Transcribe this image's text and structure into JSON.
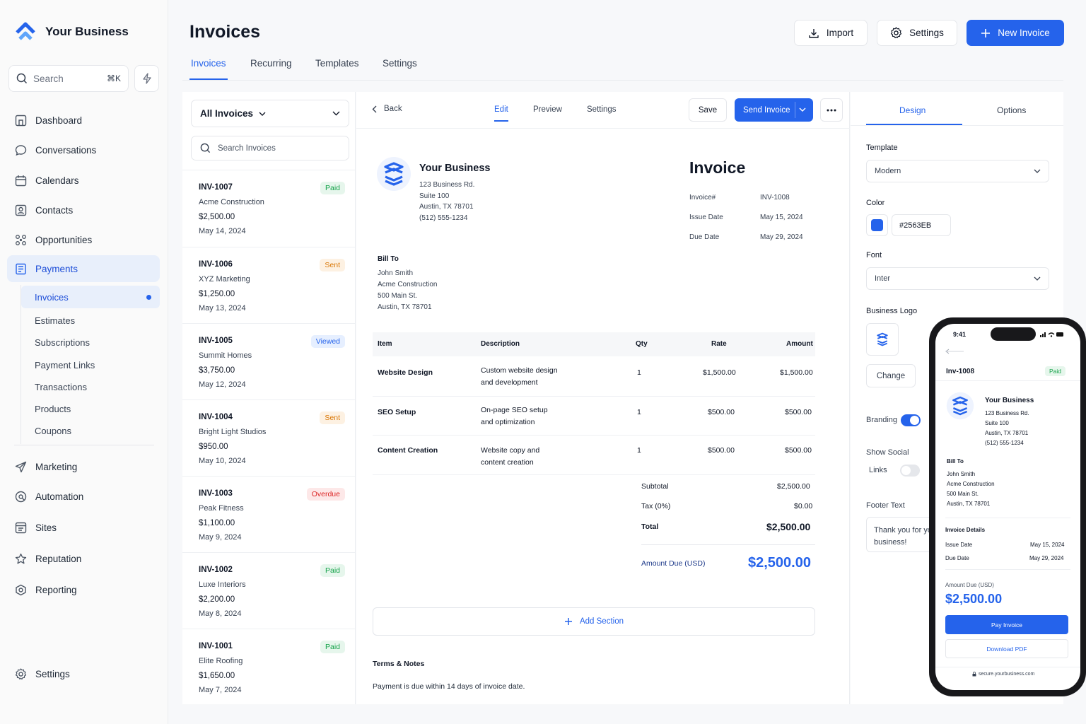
{
  "sidebar": {
    "brand": "Your Business",
    "search": {
      "placeholder": "Search",
      "shortcut": "⌘K"
    },
    "nav": [
      {
        "label": "Dashboard",
        "icon": "dashboard-icon"
      },
      {
        "label": "Conversations",
        "icon": "chat-icon"
      },
      {
        "label": "Calendars",
        "icon": "calendar-icon"
      },
      {
        "label": "Contacts",
        "icon": "contacts-icon"
      },
      {
        "label": "Opportunities",
        "icon": "opportunities-icon"
      },
      {
        "label": "Payments",
        "icon": "payments-icon"
      }
    ],
    "payments_sub": [
      "Invoices",
      "Estimates",
      "Subscriptions",
      "Payment Links",
      "Transactions",
      "Products",
      "Coupons"
    ],
    "nav2": [
      {
        "label": "Marketing",
        "icon": "send-icon"
      },
      {
        "label": "Automation",
        "icon": "automation-icon"
      },
      {
        "label": "Sites",
        "icon": "sites-icon"
      },
      {
        "label": "Reputation",
        "icon": "star-icon"
      },
      {
        "label": "Reporting",
        "icon": "reporting-icon"
      }
    ],
    "settings": "Settings"
  },
  "header": {
    "title": "Invoices",
    "import": "Import",
    "settings": "Settings",
    "new_invoice": "New Invoice",
    "tabs": [
      "Invoices",
      "Recurring",
      "Templates",
      "Settings"
    ]
  },
  "list": {
    "filter": "All Invoices",
    "search_placeholder": "Search Invoices",
    "items": [
      {
        "num": "INV-1007",
        "client": "Acme Construction",
        "amount": "$2,500.00",
        "date": "May 14, 2024",
        "status": "Paid"
      },
      {
        "num": "INV-1006",
        "client": "XYZ Marketing",
        "amount": "$1,250.00",
        "date": "May 13, 2024",
        "status": "Sent"
      },
      {
        "num": "INV-1005",
        "client": "Summit Homes",
        "amount": "$3,750.00",
        "date": "May 12, 2024",
        "status": "Viewed"
      },
      {
        "num": "INV-1004",
        "client": "Bright Light Studios",
        "amount": "$950.00",
        "date": "May 10, 2024",
        "status": "Sent"
      },
      {
        "num": "INV-1003",
        "client": "Peak Fitness",
        "amount": "$1,100.00",
        "date": "May 9, 2024",
        "status": "Overdue"
      },
      {
        "num": "INV-1002",
        "client": "Luxe Interiors",
        "amount": "$2,200.00",
        "date": "May 8, 2024",
        "status": "Paid"
      },
      {
        "num": "INV-1001",
        "client": "Elite Roofing",
        "amount": "$1,650.00",
        "date": "May 7, 2024",
        "status": "Paid"
      }
    ]
  },
  "editor": {
    "back": "Back",
    "tabs": [
      "Edit",
      "Preview",
      "Settings"
    ],
    "save": "Save",
    "send": "Send Invoice",
    "business": {
      "name": "Your Business",
      "addr1": "123 Business Rd.",
      "addr2": "Suite 100",
      "addr3": "Austin, TX 78701",
      "phone": "(512) 555-1234"
    },
    "invoice_title": "Invoice",
    "meta": [
      {
        "label": "Invoice#",
        "value": "INV-1008"
      },
      {
        "label": "Issue Date",
        "value": "May 15, 2024"
      },
      {
        "label": "Due Date",
        "value": "May 29, 2024"
      }
    ],
    "bill_to": {
      "label": "Bill To",
      "name": "John Smith",
      "company": "Acme Construction",
      "addr1": "500 Main St.",
      "addr2": "Austin, TX 78701"
    },
    "table_headers": [
      "Item",
      "Description",
      "Qty",
      "Rate",
      "Amount"
    ],
    "rows": [
      {
        "item": "Website Design",
        "desc1": "Custom website design",
        "desc2": "and development",
        "qty": "1",
        "rate": "$1,500.00",
        "amount": "$1,500.00"
      },
      {
        "item": "SEO Setup",
        "desc1": "On-page SEO setup",
        "desc2": "and optimization",
        "qty": "1",
        "rate": "$500.00",
        "amount": "$500.00"
      },
      {
        "item": "Content Creation",
        "desc1": "Website copy and",
        "desc2": "content creation",
        "qty": "1",
        "rate": "$500.00",
        "amount": "$500.00"
      }
    ],
    "subtotal_label": "Subtotal",
    "subtotal": "$2,500.00",
    "tax_label": "Tax (0%)",
    "tax": "$0.00",
    "total_label": "Total",
    "total": "$2,500.00",
    "amount_due_label": "Amount Due (USD)",
    "amount_due": "$2,500.00",
    "add_section": "Add Section",
    "terms_label": "Terms & Notes",
    "terms_text": "Payment is due within 14 days of invoice date."
  },
  "design": {
    "tabs": [
      "Design",
      "Options"
    ],
    "template_label": "Template",
    "template": "Modern",
    "color_label": "Color",
    "color": "#2563EB",
    "font_label": "Font",
    "font": "Inter",
    "logo_label": "Business Logo",
    "change": "Change",
    "branding": "Branding",
    "show_social": "Show Social",
    "links": "Links",
    "footer_label": "Footer Text",
    "footer_text1": "Thank you for yo",
    "footer_text2": "business!"
  },
  "phone": {
    "time": "9:41",
    "invoice_num": "Inv-1008",
    "status": "Paid",
    "business": {
      "name": "Your Business",
      "addr1": "123 Business Rd.",
      "addr2": "Suite 100",
      "addr3": "Austin, TX 78701",
      "phone": "(512) 555-1234"
    },
    "bill_to": {
      "label": "Bill To",
      "name": "John Smith",
      "company": "Acme Construction",
      "addr1": "500 Main St.",
      "addr2": "Austin, TX 78701"
    },
    "details_label": "Invoice Details",
    "issue_label": "Issue Date",
    "issue": "May 15, 2024",
    "due_label": "Due Date",
    "due": "May 29, 2024",
    "amount_label": "Amount Due (USD)",
    "amount": "$2,500.00",
    "pay": "Pay Invoice",
    "download": "Download PDF",
    "url": "secure.yourbusiness.com"
  },
  "colors": {
    "accent": "#2563EB",
    "paid": "#16A34A",
    "sent": "#D97706",
    "overdue": "#DC2626"
  }
}
